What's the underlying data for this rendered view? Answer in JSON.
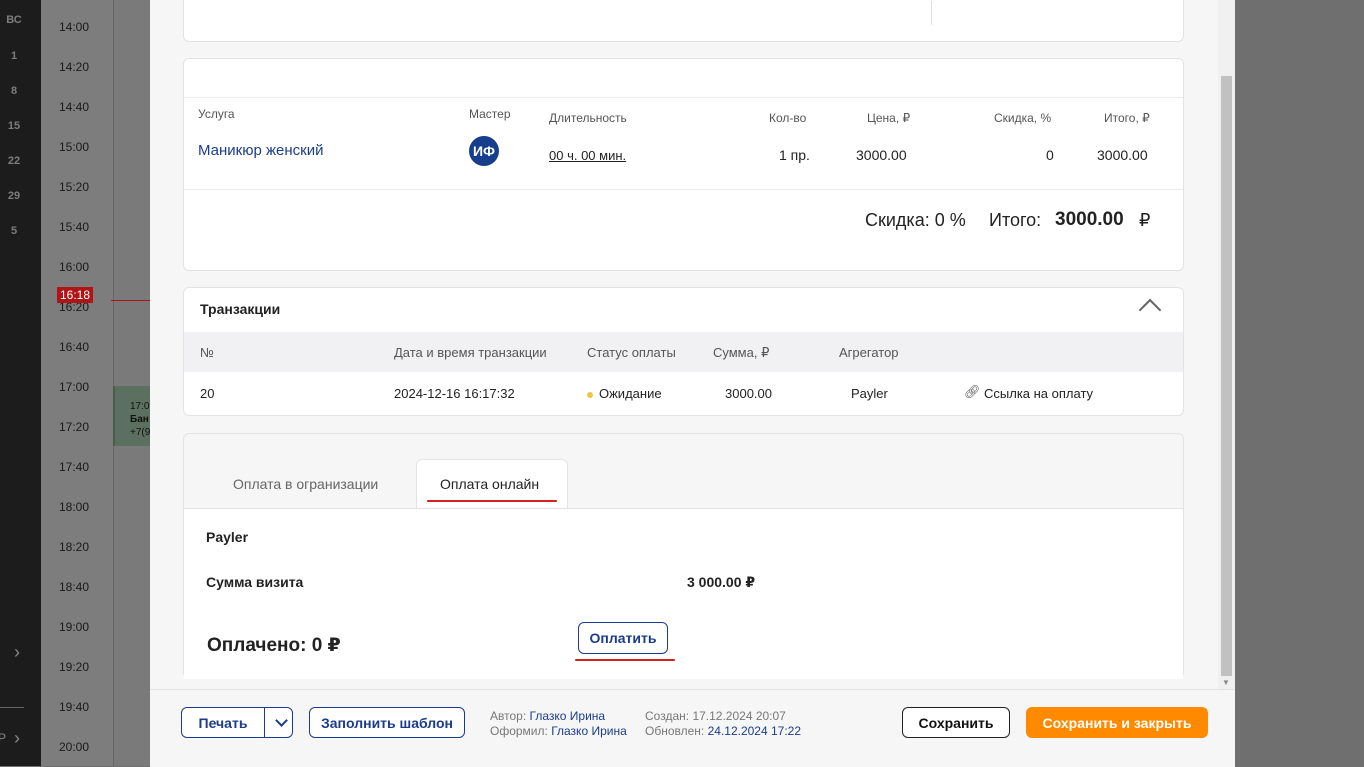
{
  "left_sidebar": {
    "labels": [
      "ВС",
      "1",
      "8",
      "15",
      "22",
      "29",
      "5"
    ],
    "expand_icon": "chevron-right-icon",
    "bottom_icon": "chevron-right-icon",
    "bottom_label": "Р"
  },
  "calendar": {
    "times": [
      "14:00",
      "14:20",
      "14:40",
      "15:00",
      "15:20",
      "15:40",
      "16:00",
      "16:20",
      "16:40",
      "17:00",
      "17:20",
      "17:40",
      "18:00",
      "18:20",
      "18:40",
      "19:00",
      "19:20",
      "19:40",
      "20:00"
    ],
    "now_time": "16:18",
    "event": {
      "time": "17:0",
      "title": "Бан",
      "phone": "+7(9"
    }
  },
  "services": {
    "headers": {
      "service": "Услуга",
      "master": "Мастер",
      "duration": "Длительность",
      "qty": "Кол-во",
      "price": "Цена, ₽",
      "discount": "Скидка, %",
      "total": "Итого, ₽"
    },
    "row": {
      "service": "Маникюр женский",
      "master_initials": "ИФ",
      "duration": "00 ч. 00 мин.",
      "qty": "1 пр.",
      "price": "3000.00",
      "discount": "0",
      "total": "3000.00"
    },
    "summary": {
      "discount_label": "Скидка: 0 %",
      "total_label": "Итого:",
      "total_value": "3000.00",
      "currency": "₽"
    }
  },
  "transactions": {
    "title": "Транзакции",
    "headers": {
      "num": "№",
      "datetime": "Дата и время транзакции",
      "status": "Статус оплаты",
      "amount": "Сумма, ₽",
      "aggregator": "Агрегатор"
    },
    "rows": [
      {
        "num": "20",
        "datetime": "2024-12-16 16:17:32",
        "status": "Ожидание",
        "status_color": "#f5c242",
        "amount": "3000.00",
        "aggregator": "Payler",
        "link": "Ссылка на оплату"
      }
    ]
  },
  "payment": {
    "tabs": [
      "Оплата в огранизации",
      "Оплата онлайн"
    ],
    "active_tab": 1,
    "provider": "Payler",
    "visit_sum_label": "Сумма визита",
    "visit_sum_value": "3 000.00 ₽",
    "paid_label": "Оплачено: 0 ₽",
    "pay_button": "Оплатить"
  },
  "footer": {
    "print": "Печать",
    "fill_template": "Заполнить шаблон",
    "author_label": "Автор:",
    "author": "Глазко Ирина",
    "issued_label": "Оформил:",
    "issued": "Глазко Ирина",
    "created_label": "Создан:",
    "created": "17.12.2024 20:07",
    "updated_label": "Обновлен:",
    "updated": "24.12.2024 17:22",
    "save": "Сохранить",
    "save_close": "Сохранить и закрыть",
    "accent_color": "#ff8a00",
    "brand_color": "#1b3c8c"
  }
}
